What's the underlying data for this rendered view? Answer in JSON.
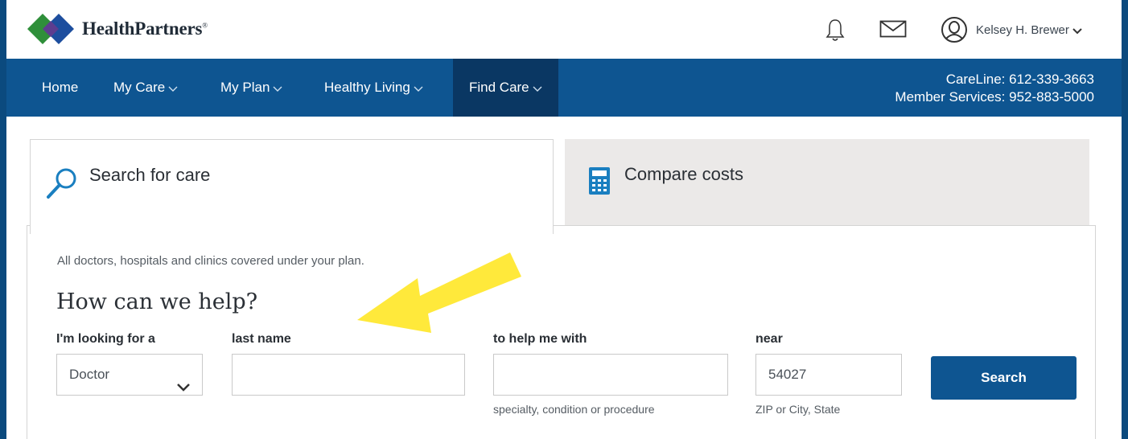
{
  "header": {
    "logo_text": "HealthPartners",
    "logo_mark": "®",
    "user_name": "Kelsey H. Brewer",
    "icons": [
      "bell-icon",
      "mail-icon",
      "user-icon",
      "chevron-down-icon"
    ]
  },
  "nav": {
    "items": [
      {
        "label": "Home"
      },
      {
        "label": "My Care"
      },
      {
        "label": "My Plan"
      },
      {
        "label": "Healthy Living"
      },
      {
        "label": "Find Care"
      }
    ],
    "careline": "CareLine: 612-339-3663",
    "member_services": "Member Services: 952-883-5000"
  },
  "tabs": [
    {
      "label": "Search for care",
      "icon": "search-icon"
    },
    {
      "label": "Compare costs",
      "icon": "calculator-icon"
    }
  ],
  "search": {
    "intro": "All doctors, hospitals and clinics covered under your plan.",
    "heading": "How can we help?",
    "looking_for_label": "I'm looking for a",
    "looking_for_value": "Doctor",
    "last_name_label": "last name",
    "last_name_value": "",
    "help_label": "to help me with",
    "help_value": "",
    "help_hint": "specialty, condition or procedure",
    "near_label": "near",
    "near_value": "54027",
    "near_hint": "ZIP or City, State",
    "button": "Search"
  },
  "colors": {
    "nav_bg": "#0e5591",
    "nav_active": "#0a3763",
    "border_frame": "#0b4a7e",
    "button_bg": "#0e5591",
    "arrow": "#ffe93b"
  }
}
